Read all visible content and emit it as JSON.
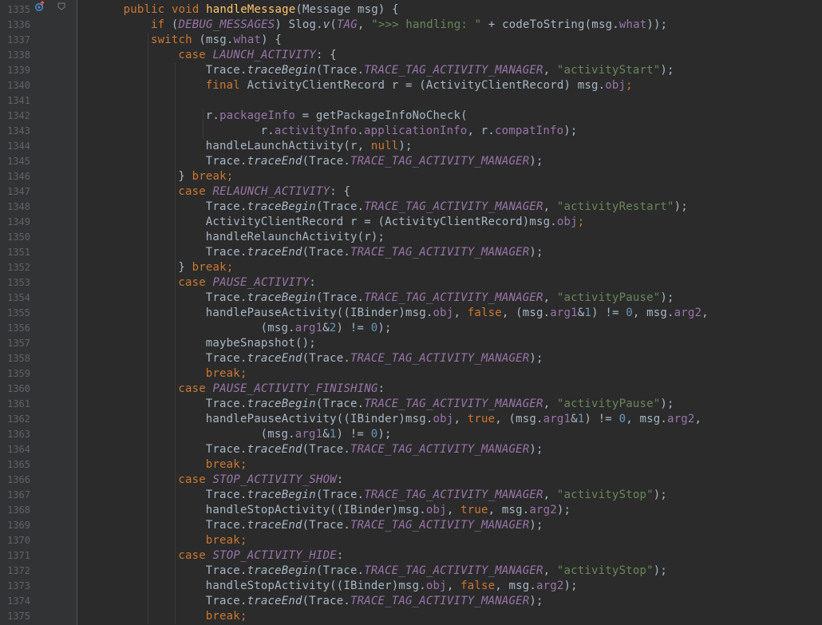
{
  "editor": {
    "theme": "darcula",
    "colors": {
      "background": "#2b2b2b",
      "gutter": "#313335",
      "line_number": "#606366",
      "keyword": "#cc7832",
      "function": "#ffc66d",
      "string": "#6a8759",
      "number": "#6897bb",
      "constant": "#9876aa",
      "text": "#a9b7c6"
    },
    "gutter_icons": {
      "override": "override-method-icon",
      "fold": "fold-marker-icon"
    },
    "lines": [
      {
        "number": "1335",
        "indent": 6,
        "tokens": [
          [
            "kw",
            "public "
          ],
          [
            "kw",
            "void "
          ],
          [
            "fn",
            "handleMessage"
          ],
          [
            "p",
            "(Message msg) {"
          ]
        ]
      },
      {
        "number": "1336",
        "indent": 10,
        "tokens": [
          [
            "kw",
            "if "
          ],
          [
            "p",
            "("
          ],
          [
            "const",
            "DEBUG_MESSAGES"
          ],
          [
            "p",
            ") Slog."
          ],
          [
            "it",
            "v"
          ],
          [
            "p",
            "("
          ],
          [
            "const",
            "TAG"
          ],
          [
            "p",
            ", "
          ],
          [
            "str",
            "\">>> handling: \""
          ],
          [
            "p",
            " + codeToString(msg."
          ],
          [
            "field",
            "what"
          ],
          [
            "p",
            "));"
          ]
        ]
      },
      {
        "number": "1337",
        "indent": 10,
        "tokens": [
          [
            "kw",
            "switch "
          ],
          [
            "p",
            "(msg."
          ],
          [
            "field",
            "what"
          ],
          [
            "p",
            ") {"
          ]
        ]
      },
      {
        "number": "1338",
        "indent": 14,
        "tokens": [
          [
            "kw",
            "case "
          ],
          [
            "const",
            "LAUNCH_ACTIVITY"
          ],
          [
            "p",
            ": {"
          ]
        ]
      },
      {
        "number": "1339",
        "indent": 18,
        "tokens": [
          [
            "p",
            "Trace."
          ],
          [
            "it",
            "traceBegin"
          ],
          [
            "p",
            "(Trace."
          ],
          [
            "const",
            "TRACE_TAG_ACTIVITY_MANAGER"
          ],
          [
            "p",
            ", "
          ],
          [
            "str",
            "\"activityStart\""
          ],
          [
            "p",
            ");"
          ]
        ]
      },
      {
        "number": "1340",
        "indent": 18,
        "tokens": [
          [
            "kw",
            "final "
          ],
          [
            "p",
            "ActivityClientRecord r = (ActivityClientRecord) msg."
          ],
          [
            "field",
            "obj"
          ],
          [
            "kw",
            ";"
          ]
        ]
      },
      {
        "number": "1341",
        "indent": 0,
        "tokens": []
      },
      {
        "number": "1342",
        "indent": 18,
        "tokens": [
          [
            "p",
            "r."
          ],
          [
            "field",
            "packageInfo"
          ],
          [
            "p",
            " = getPackageInfoNoCheck("
          ]
        ]
      },
      {
        "number": "1343",
        "indent": 26,
        "tokens": [
          [
            "p",
            "r."
          ],
          [
            "field",
            "activityInfo"
          ],
          [
            "p",
            "."
          ],
          [
            "field",
            "applicationInfo"
          ],
          [
            "p",
            ", r."
          ],
          [
            "field",
            "compatInfo"
          ],
          [
            "p",
            ");"
          ]
        ]
      },
      {
        "number": "1344",
        "indent": 18,
        "tokens": [
          [
            "p",
            "handleLaunchActivity(r, "
          ],
          [
            "kw",
            "null"
          ],
          [
            "p",
            ");"
          ]
        ]
      },
      {
        "number": "1345",
        "indent": 18,
        "tokens": [
          [
            "p",
            "Trace."
          ],
          [
            "it",
            "traceEnd"
          ],
          [
            "p",
            "(Trace."
          ],
          [
            "const",
            "TRACE_TAG_ACTIVITY_MANAGER"
          ],
          [
            "p",
            ");"
          ]
        ]
      },
      {
        "number": "1346",
        "indent": 14,
        "tokens": [
          [
            "p",
            "} "
          ],
          [
            "kw",
            "break;"
          ]
        ]
      },
      {
        "number": "1347",
        "indent": 14,
        "tokens": [
          [
            "kw",
            "case "
          ],
          [
            "const",
            "RELAUNCH_ACTIVITY"
          ],
          [
            "p",
            ": {"
          ]
        ]
      },
      {
        "number": "1348",
        "indent": 18,
        "tokens": [
          [
            "p",
            "Trace."
          ],
          [
            "it",
            "traceBegin"
          ],
          [
            "p",
            "(Trace."
          ],
          [
            "const",
            "TRACE_TAG_ACTIVITY_MANAGER"
          ],
          [
            "p",
            ", "
          ],
          [
            "str",
            "\"activityRestart\""
          ],
          [
            "p",
            ");"
          ]
        ]
      },
      {
        "number": "1349",
        "indent": 18,
        "tokens": [
          [
            "p",
            "ActivityClientRecord r = (ActivityClientRecord)msg."
          ],
          [
            "field",
            "obj"
          ],
          [
            "kw",
            ";"
          ]
        ]
      },
      {
        "number": "1350",
        "indent": 18,
        "tokens": [
          [
            "p",
            "handleRelaunchActivity(r);"
          ]
        ]
      },
      {
        "number": "1351",
        "indent": 18,
        "tokens": [
          [
            "p",
            "Trace."
          ],
          [
            "it",
            "traceEnd"
          ],
          [
            "p",
            "(Trace."
          ],
          [
            "const",
            "TRACE_TAG_ACTIVITY_MANAGER"
          ],
          [
            "p",
            ");"
          ]
        ]
      },
      {
        "number": "1352",
        "indent": 14,
        "tokens": [
          [
            "p",
            "} "
          ],
          [
            "kw",
            "break;"
          ]
        ]
      },
      {
        "number": "1353",
        "indent": 14,
        "tokens": [
          [
            "kw",
            "case "
          ],
          [
            "const",
            "PAUSE_ACTIVITY"
          ],
          [
            "p",
            ":"
          ]
        ]
      },
      {
        "number": "1354",
        "indent": 18,
        "tokens": [
          [
            "p",
            "Trace."
          ],
          [
            "it",
            "traceBegin"
          ],
          [
            "p",
            "(Trace."
          ],
          [
            "const",
            "TRACE_TAG_ACTIVITY_MANAGER"
          ],
          [
            "p",
            ", "
          ],
          [
            "str",
            "\"activityPause\""
          ],
          [
            "p",
            ");"
          ]
        ]
      },
      {
        "number": "1355",
        "indent": 18,
        "tokens": [
          [
            "p",
            "handlePauseActivity((IBinder)msg."
          ],
          [
            "field",
            "obj"
          ],
          [
            "p",
            ", "
          ],
          [
            "kw",
            "false"
          ],
          [
            "p",
            ", (msg."
          ],
          [
            "field",
            "arg1"
          ],
          [
            "p",
            "&"
          ],
          [
            "num",
            "1"
          ],
          [
            "p",
            ") != "
          ],
          [
            "num",
            "0"
          ],
          [
            "p",
            ", msg."
          ],
          [
            "field",
            "arg2"
          ],
          [
            "p",
            ","
          ]
        ]
      },
      {
        "number": "1356",
        "indent": 26,
        "tokens": [
          [
            "p",
            "(msg."
          ],
          [
            "field",
            "arg1"
          ],
          [
            "p",
            "&"
          ],
          [
            "num",
            "2"
          ],
          [
            "p",
            ") != "
          ],
          [
            "num",
            "0"
          ],
          [
            "p",
            ");"
          ]
        ]
      },
      {
        "number": "1357",
        "indent": 18,
        "tokens": [
          [
            "p",
            "maybeSnapshot();"
          ]
        ]
      },
      {
        "number": "1358",
        "indent": 18,
        "tokens": [
          [
            "p",
            "Trace."
          ],
          [
            "it",
            "traceEnd"
          ],
          [
            "p",
            "(Trace."
          ],
          [
            "const",
            "TRACE_TAG_ACTIVITY_MANAGER"
          ],
          [
            "p",
            ");"
          ]
        ]
      },
      {
        "number": "1359",
        "indent": 18,
        "tokens": [
          [
            "kw",
            "break;"
          ]
        ]
      },
      {
        "number": "1360",
        "indent": 14,
        "tokens": [
          [
            "kw",
            "case "
          ],
          [
            "const",
            "PAUSE_ACTIVITY_FINISHING"
          ],
          [
            "p",
            ":"
          ]
        ]
      },
      {
        "number": "1361",
        "indent": 18,
        "tokens": [
          [
            "p",
            "Trace."
          ],
          [
            "it",
            "traceBegin"
          ],
          [
            "p",
            "(Trace."
          ],
          [
            "const",
            "TRACE_TAG_ACTIVITY_MANAGER"
          ],
          [
            "p",
            ", "
          ],
          [
            "str",
            "\"activityPause\""
          ],
          [
            "p",
            ");"
          ]
        ]
      },
      {
        "number": "1362",
        "indent": 18,
        "tokens": [
          [
            "p",
            "handlePauseActivity((IBinder)msg."
          ],
          [
            "field",
            "obj"
          ],
          [
            "p",
            ", "
          ],
          [
            "kw",
            "true"
          ],
          [
            "p",
            ", (msg."
          ],
          [
            "field",
            "arg1"
          ],
          [
            "p",
            "&"
          ],
          [
            "num",
            "1"
          ],
          [
            "p",
            ") != "
          ],
          [
            "num",
            "0"
          ],
          [
            "p",
            ", msg."
          ],
          [
            "field",
            "arg2"
          ],
          [
            "p",
            ","
          ]
        ]
      },
      {
        "number": "1363",
        "indent": 26,
        "tokens": [
          [
            "p",
            "(msg."
          ],
          [
            "field",
            "arg1"
          ],
          [
            "p",
            "&"
          ],
          [
            "num",
            "1"
          ],
          [
            "p",
            ") != "
          ],
          [
            "num",
            "0"
          ],
          [
            "p",
            ");"
          ]
        ]
      },
      {
        "number": "1364",
        "indent": 18,
        "tokens": [
          [
            "p",
            "Trace."
          ],
          [
            "it",
            "traceEnd"
          ],
          [
            "p",
            "(Trace."
          ],
          [
            "const",
            "TRACE_TAG_ACTIVITY_MANAGER"
          ],
          [
            "p",
            ");"
          ]
        ]
      },
      {
        "number": "1365",
        "indent": 18,
        "tokens": [
          [
            "kw",
            "break;"
          ]
        ]
      },
      {
        "number": "1366",
        "indent": 14,
        "tokens": [
          [
            "kw",
            "case "
          ],
          [
            "const",
            "STOP_ACTIVITY_SHOW"
          ],
          [
            "p",
            ":"
          ]
        ]
      },
      {
        "number": "1367",
        "indent": 18,
        "tokens": [
          [
            "p",
            "Trace."
          ],
          [
            "it",
            "traceBegin"
          ],
          [
            "p",
            "(Trace."
          ],
          [
            "const",
            "TRACE_TAG_ACTIVITY_MANAGER"
          ],
          [
            "p",
            ", "
          ],
          [
            "str",
            "\"activityStop\""
          ],
          [
            "p",
            ");"
          ]
        ]
      },
      {
        "number": "1368",
        "indent": 18,
        "tokens": [
          [
            "p",
            "handleStopActivity((IBinder)msg."
          ],
          [
            "field",
            "obj"
          ],
          [
            "p",
            ", "
          ],
          [
            "kw",
            "true"
          ],
          [
            "p",
            ", msg."
          ],
          [
            "field",
            "arg2"
          ],
          [
            "p",
            ");"
          ]
        ]
      },
      {
        "number": "1369",
        "indent": 18,
        "tokens": [
          [
            "p",
            "Trace."
          ],
          [
            "it",
            "traceEnd"
          ],
          [
            "p",
            "(Trace."
          ],
          [
            "const",
            "TRACE_TAG_ACTIVITY_MANAGER"
          ],
          [
            "p",
            ");"
          ]
        ]
      },
      {
        "number": "1370",
        "indent": 18,
        "tokens": [
          [
            "kw",
            "break;"
          ]
        ]
      },
      {
        "number": "1371",
        "indent": 14,
        "tokens": [
          [
            "kw",
            "case "
          ],
          [
            "const",
            "STOP_ACTIVITY_HIDE"
          ],
          [
            "p",
            ":"
          ]
        ]
      },
      {
        "number": "1372",
        "indent": 18,
        "tokens": [
          [
            "p",
            "Trace."
          ],
          [
            "it",
            "traceBegin"
          ],
          [
            "p",
            "(Trace."
          ],
          [
            "const",
            "TRACE_TAG_ACTIVITY_MANAGER"
          ],
          [
            "p",
            ", "
          ],
          [
            "str",
            "\"activityStop\""
          ],
          [
            "p",
            ");"
          ]
        ]
      },
      {
        "number": "1373",
        "indent": 18,
        "tokens": [
          [
            "p",
            "handleStopActivity((IBinder)msg."
          ],
          [
            "field",
            "obj"
          ],
          [
            "p",
            ", "
          ],
          [
            "kw",
            "false"
          ],
          [
            "p",
            ", msg."
          ],
          [
            "field",
            "arg2"
          ],
          [
            "p",
            ");"
          ]
        ]
      },
      {
        "number": "1374",
        "indent": 18,
        "tokens": [
          [
            "p",
            "Trace."
          ],
          [
            "it",
            "traceEnd"
          ],
          [
            "p",
            "(Trace."
          ],
          [
            "const",
            "TRACE_TAG_ACTIVITY_MANAGER"
          ],
          [
            "p",
            ");"
          ]
        ]
      },
      {
        "number": "1375",
        "indent": 18,
        "tokens": [
          [
            "kw",
            "break;"
          ]
        ]
      }
    ]
  }
}
